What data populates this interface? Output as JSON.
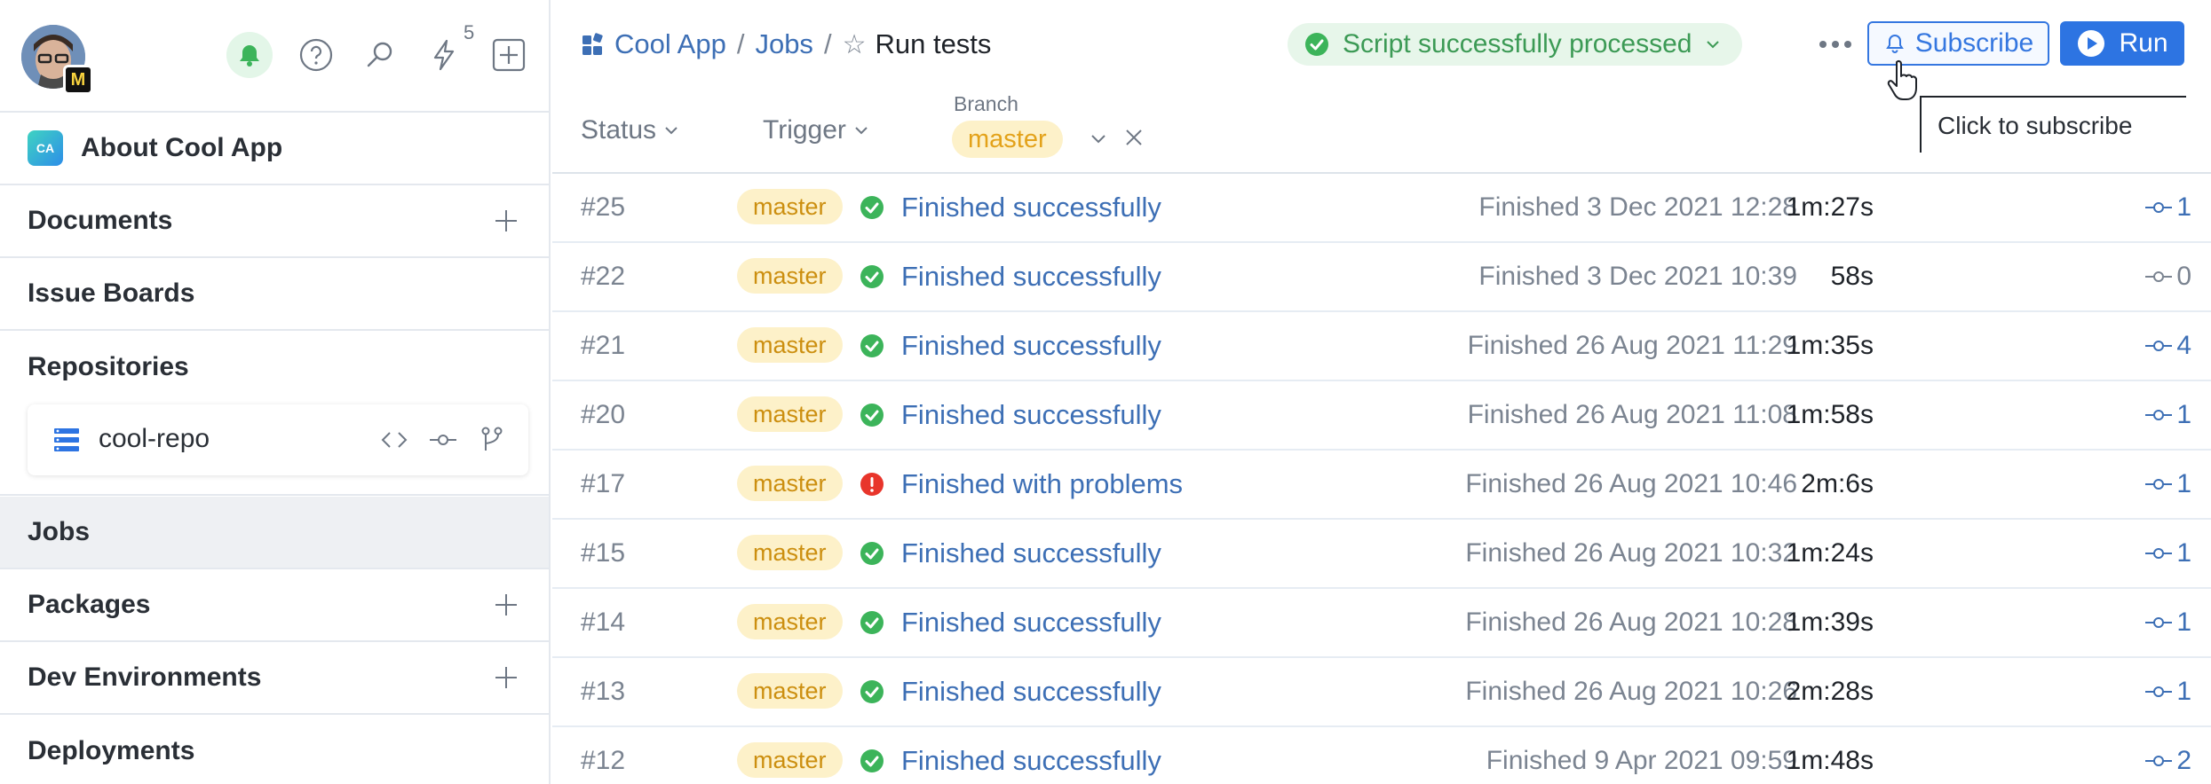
{
  "sidebar": {
    "notification_count": "5",
    "app": {
      "logo_text": "CA",
      "title": "About Cool App"
    },
    "items": [
      {
        "label": "Documents"
      },
      {
        "label": "Issue Boards"
      },
      {
        "label": "Repositories"
      },
      {
        "label": "Jobs"
      },
      {
        "label": "Packages"
      },
      {
        "label": "Dev Environments"
      },
      {
        "label": "Deployments"
      }
    ],
    "repo": {
      "name": "cool-repo"
    },
    "avatar_badge": "M"
  },
  "header": {
    "breadcrumb": [
      "Cool App",
      "Jobs"
    ],
    "current": "Run tests",
    "status": "Script successfully processed",
    "subscribe_label": "Subscribe",
    "run_label": "Run",
    "tooltip": "Click to subscribe"
  },
  "filters": {
    "status_label": "Status",
    "trigger_label": "Trigger",
    "branch_label": "Branch",
    "branch_value": "master"
  },
  "colors": {
    "accent": "#2d74e2",
    "success": "#3cb45a",
    "error": "#e8352b",
    "branch_chip_bg": "#fdf1c9"
  },
  "jobs": [
    {
      "number": "#25",
      "branch": "master",
      "status": "success",
      "status_text": "Finished successfully",
      "finished": "Finished 3 Dec 2021 12:28",
      "duration": "1m:27s",
      "commits": "1"
    },
    {
      "number": "#22",
      "branch": "master",
      "status": "success",
      "status_text": "Finished successfully",
      "finished": "Finished 3 Dec 2021 10:39",
      "duration": "58s",
      "commits": "0"
    },
    {
      "number": "#21",
      "branch": "master",
      "status": "success",
      "status_text": "Finished successfully",
      "finished": "Finished 26 Aug 2021 11:29",
      "duration": "1m:35s",
      "commits": "4"
    },
    {
      "number": "#20",
      "branch": "master",
      "status": "success",
      "status_text": "Finished successfully",
      "finished": "Finished 26 Aug 2021 11:08",
      "duration": "1m:58s",
      "commits": "1"
    },
    {
      "number": "#17",
      "branch": "master",
      "status": "problem",
      "status_text": "Finished with problems",
      "finished": "Finished 26 Aug 2021 10:46",
      "duration": "2m:6s",
      "commits": "1"
    },
    {
      "number": "#15",
      "branch": "master",
      "status": "success",
      "status_text": "Finished successfully",
      "finished": "Finished 26 Aug 2021 10:32",
      "duration": "1m:24s",
      "commits": "1"
    },
    {
      "number": "#14",
      "branch": "master",
      "status": "success",
      "status_text": "Finished successfully",
      "finished": "Finished 26 Aug 2021 10:28",
      "duration": "1m:39s",
      "commits": "1"
    },
    {
      "number": "#13",
      "branch": "master",
      "status": "success",
      "status_text": "Finished successfully",
      "finished": "Finished 26 Aug 2021 10:26",
      "duration": "2m:28s",
      "commits": "1"
    },
    {
      "number": "#12",
      "branch": "master",
      "status": "success",
      "status_text": "Finished successfully",
      "finished": "Finished 9 Apr 2021 09:59",
      "duration": "1m:48s",
      "commits": "2"
    }
  ]
}
